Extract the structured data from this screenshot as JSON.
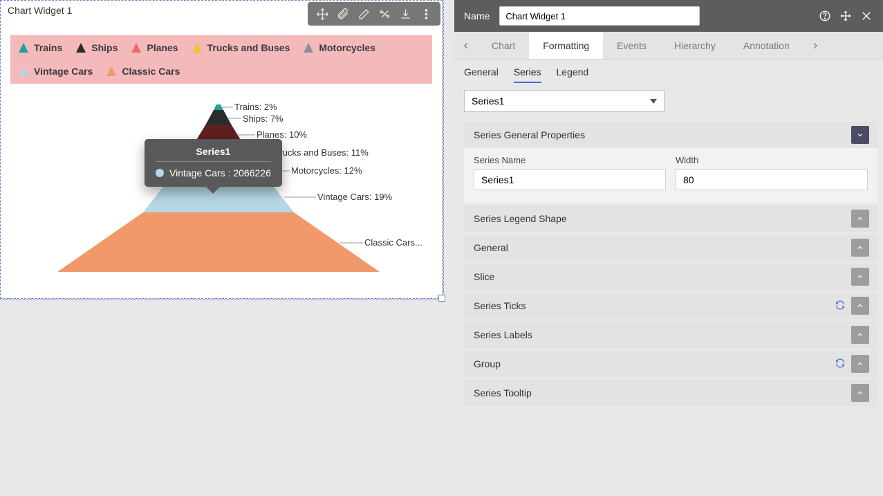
{
  "widget": {
    "title": "Chart Widget 1",
    "toolbar_icons": [
      "move",
      "attach",
      "edit",
      "tools",
      "download",
      "more"
    ]
  },
  "legend": {
    "items": [
      {
        "label": "Trains",
        "color": "#1aa39a"
      },
      {
        "label": "Ships",
        "color": "#2c2c2c"
      },
      {
        "label": "Planes",
        "color": "#f06a6a"
      },
      {
        "label": "Trucks and Buses",
        "color": "#f2c232"
      },
      {
        "label": "Motorcycles",
        "color": "#8a8f98"
      },
      {
        "label": "Vintage Cars",
        "color": "#b6d7e4"
      },
      {
        "label": "Classic Cars",
        "color": "#f1996a"
      }
    ]
  },
  "chart_labels": {
    "trains": "Trains: 2%",
    "ships": "Ships: 7%",
    "planes": "Planes: 10%",
    "trucks": "Trucks and Buses: 11%",
    "motorcycles": "Motorcycles: 12%",
    "vintage": "Vintage Cars: 19%",
    "classic": "Classic Cars..."
  },
  "tooltip": {
    "series_title": "Series1",
    "row_text": "Vintage Cars : 2066226",
    "dot_color": "#b6d7e4"
  },
  "panel": {
    "name_label": "Name",
    "name_value": "Chart Widget 1",
    "tabs": [
      {
        "label": "Chart",
        "active": false
      },
      {
        "label": "Formatting",
        "active": true
      },
      {
        "label": "Events",
        "active": false
      },
      {
        "label": "Hierarchy",
        "active": false
      },
      {
        "label": "Annotation",
        "active": false
      }
    ],
    "subtabs": [
      {
        "label": "General",
        "active": false
      },
      {
        "label": "Series",
        "active": true
      },
      {
        "label": "Legend",
        "active": false
      }
    ],
    "series_select": "Series1",
    "expanded_section": {
      "title": "Series General Properties",
      "series_name_label": "Series Name",
      "series_name_value": "Series1",
      "width_label": "Width",
      "width_value": "80"
    },
    "collapsed_sections": [
      {
        "title": "Series Legend Shape",
        "refresh": false
      },
      {
        "title": "General",
        "refresh": false
      },
      {
        "title": "Slice",
        "refresh": false
      },
      {
        "title": "Series Ticks",
        "refresh": true
      },
      {
        "title": "Series Labels",
        "refresh": false
      },
      {
        "title": "Group",
        "refresh": true
      },
      {
        "title": "Series Tooltip",
        "refresh": false
      }
    ]
  },
  "chart_data": {
    "type": "pie",
    "title": "",
    "categories": [
      "Trains",
      "Ships",
      "Planes",
      "Trucks and Buses",
      "Motorcycles",
      "Vintage Cars",
      "Classic Cars"
    ],
    "values_percent": [
      2,
      7,
      10,
      11,
      12,
      19,
      39
    ],
    "series": [
      {
        "name": "Series1",
        "values": [
          2,
          7,
          10,
          11,
          12,
          19,
          39
        ],
        "colors": [
          "#1aa39a",
          "#2c2c2c",
          "#f06a6a",
          "#f2c232",
          "#8a8f98",
          "#b6d7e4",
          "#f1996a"
        ]
      }
    ],
    "hovered": {
      "category": "Vintage Cars",
      "value": 2066226
    }
  }
}
